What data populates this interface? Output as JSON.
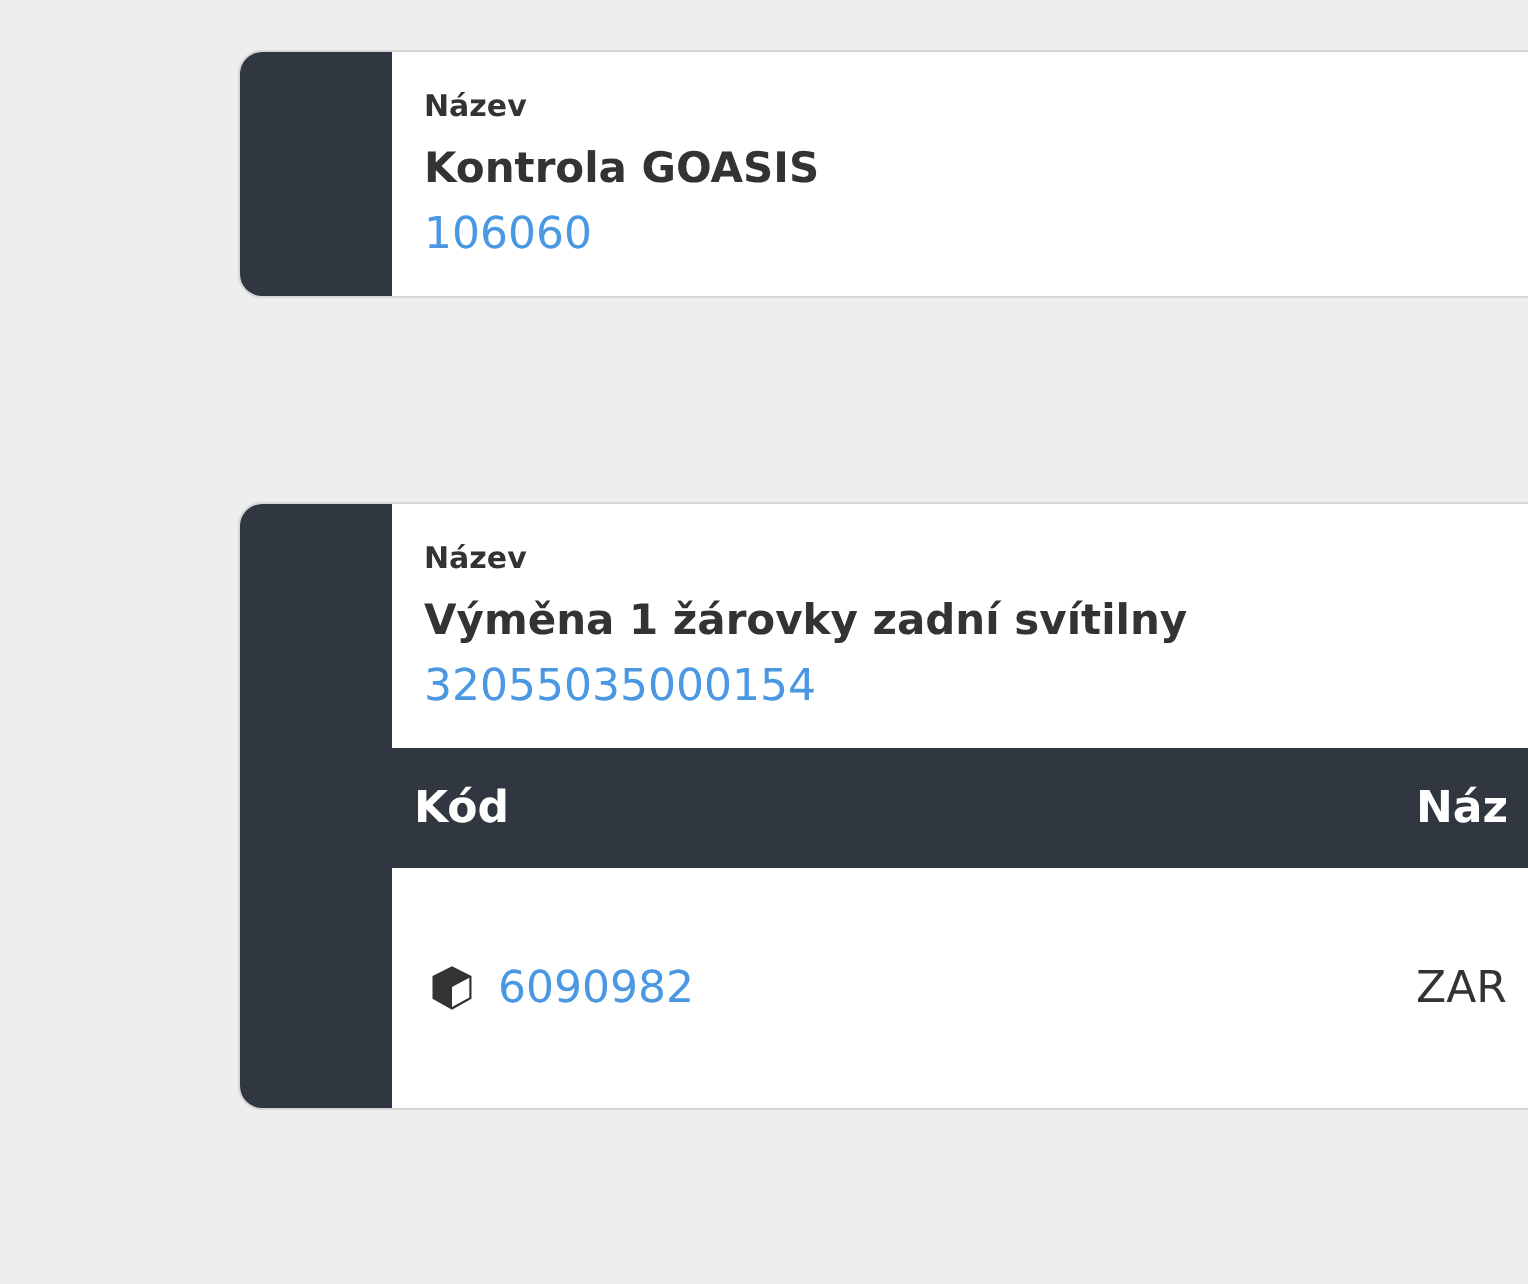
{
  "cards": [
    {
      "label": "Název",
      "title": "Kontrola GOASIS",
      "code": "106060"
    },
    {
      "label": "Název",
      "title": "Výměna 1 žárovky zadní svítilny",
      "code": "32055035000154",
      "table": {
        "columns": [
          "Kód",
          "Náz"
        ],
        "rows": [
          {
            "kind": "part",
            "cells": [
              "6090982",
              "ZAR"
            ]
          }
        ]
      }
    }
  ]
}
